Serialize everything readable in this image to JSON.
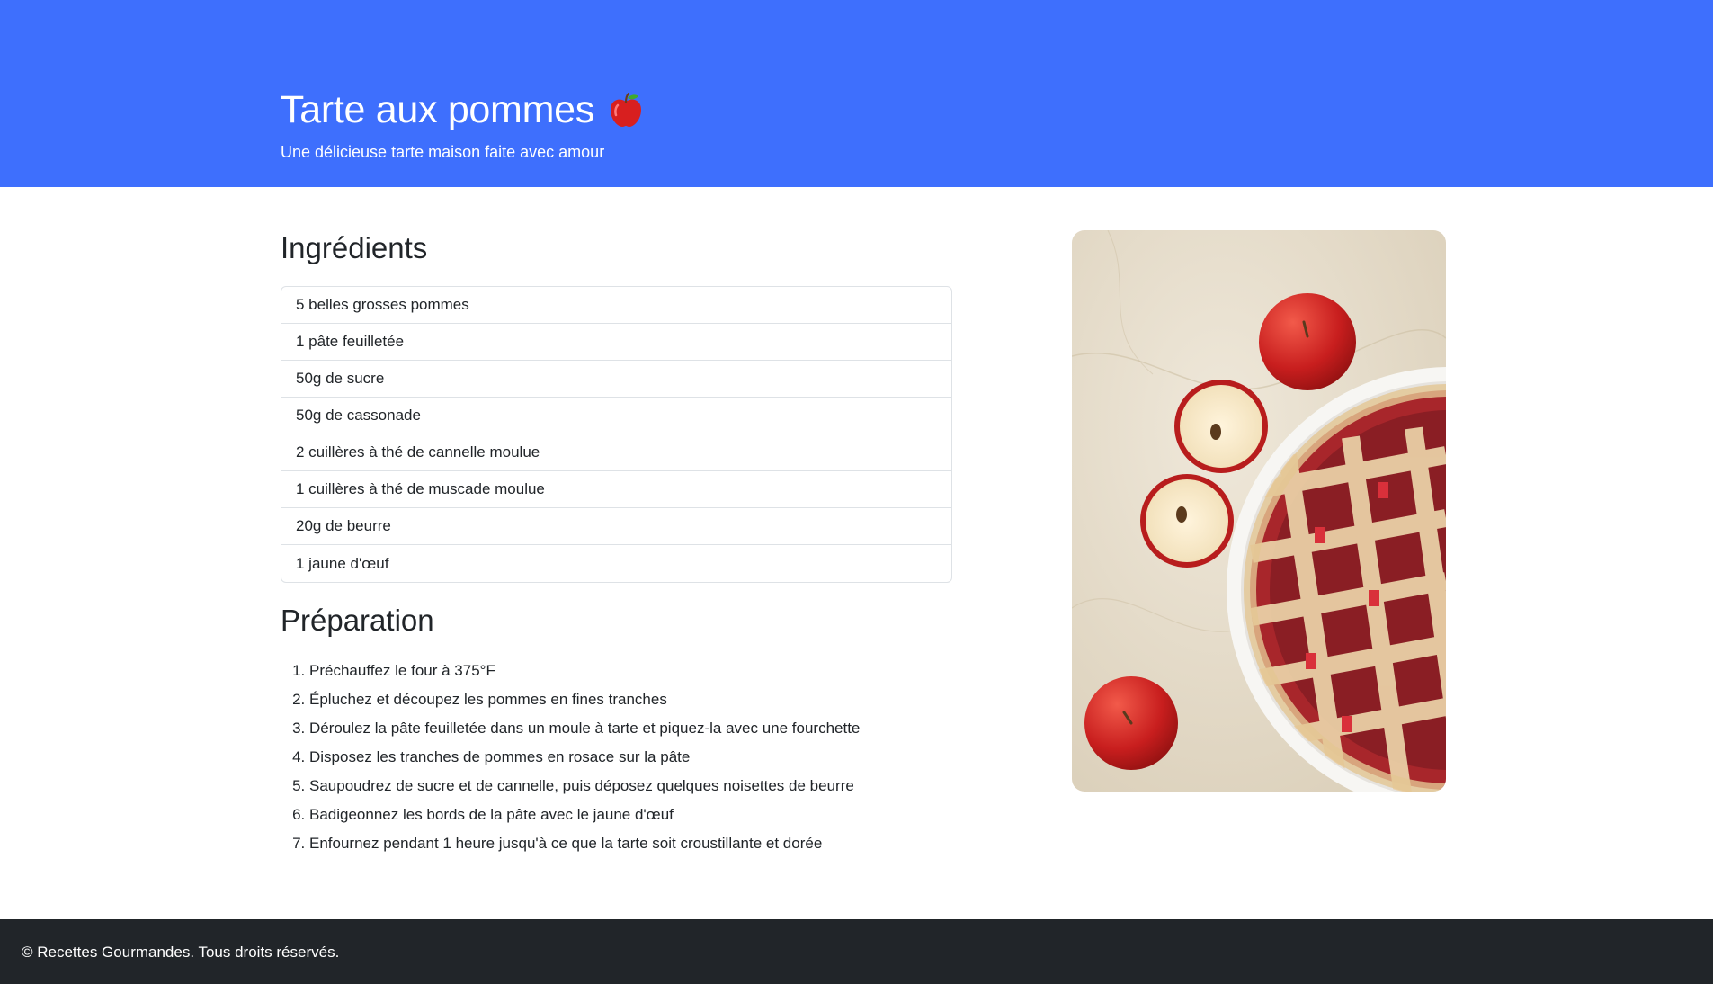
{
  "header": {
    "title": "Tarte aux pommes",
    "title_icon": "red-apple-emoji",
    "subtitle": "Une délicieuse tarte maison faite avec amour",
    "background_color": "#3e6ffd"
  },
  "ingredients": {
    "title": "Ingrédients",
    "items": [
      "5 belles grosses pommes",
      "1 pâte feuilletée",
      "50g de sucre",
      "50g de cassonade",
      "2 cuillères à thé de cannelle moulue",
      "1 cuillères à thé de muscade moulue",
      "20g de beurre",
      "1 jaune d'œuf"
    ]
  },
  "preparation": {
    "title": "Préparation",
    "steps": [
      "Préchauffez le four à 375°F",
      "Épluchez et découpez les pommes en fines tranches",
      "Déroulez la pâte feuilletée dans un moule à tarte et piquez-la avec une fourchette",
      "Disposez les tranches de pommes en rosace sur la pâte",
      "Saupoudrez de sucre et de cannelle, puis déposez quelques noisettes de beurre",
      "Badigeonnez les bords de la pâte avec le jaune d'œuf",
      "Enfournez pendant 1 heure jusqu'à ce que la tarte soit croustillante et dorée"
    ]
  },
  "photo": {
    "subject": "apple-pie-photo"
  },
  "footer": {
    "text": "© Recettes Gourmandes. Tous droits réservés.",
    "background_color": "#212529"
  }
}
